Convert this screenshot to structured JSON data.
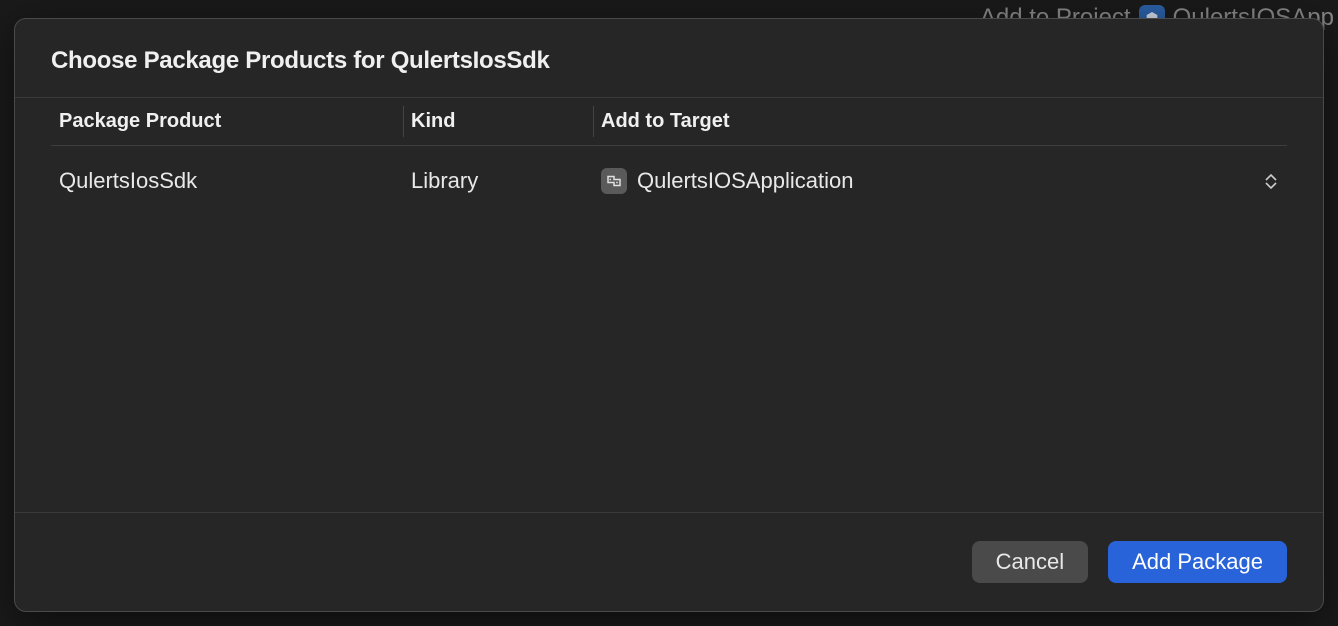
{
  "background": {
    "add_to_project_label": "Add to Project",
    "app_name_partial": "QulertsIOSApp"
  },
  "dialog": {
    "title": "Choose Package Products for QulertsIosSdk",
    "columns": {
      "product": "Package Product",
      "kind": "Kind",
      "target": "Add to Target"
    },
    "rows": [
      {
        "product": "QulertsIosSdk",
        "kind": "Library",
        "target": "QulertsIOSApplication"
      }
    ],
    "buttons": {
      "cancel": "Cancel",
      "add_package": "Add Package"
    }
  }
}
